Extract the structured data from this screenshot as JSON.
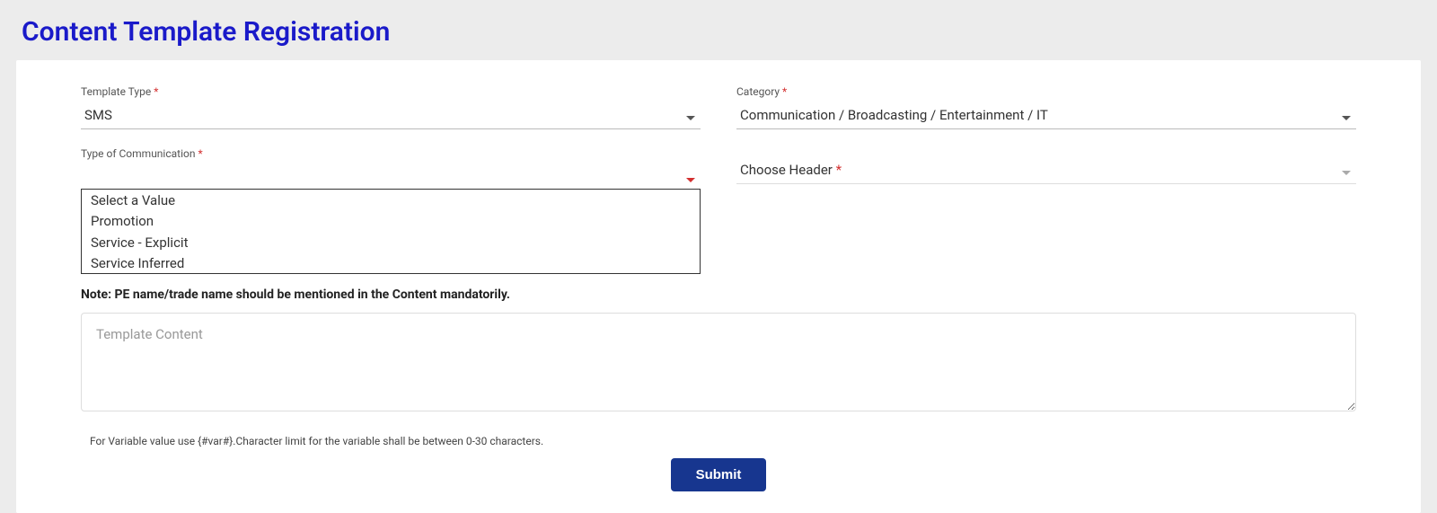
{
  "page": {
    "title": "Content Template Registration"
  },
  "form": {
    "template_type": {
      "label": "Template Type",
      "value": "SMS"
    },
    "category": {
      "label": "Category",
      "value": "Communication / Broadcasting / Entertainment / IT"
    },
    "type_of_communication": {
      "label": "Type of Communication",
      "options": [
        "Select a Value",
        "Promotion",
        "Service - Explicit",
        "Service Inferred"
      ]
    },
    "choose_header": {
      "label": "Choose Header"
    },
    "note": "Note: PE name/trade name should be mentioned in the Content mandatorily.",
    "template_content": {
      "placeholder": "Template Content"
    },
    "helper": "For Variable value use {#var#}.Character limit for the variable shall be between 0-30 characters.",
    "submit_label": "Submit"
  }
}
